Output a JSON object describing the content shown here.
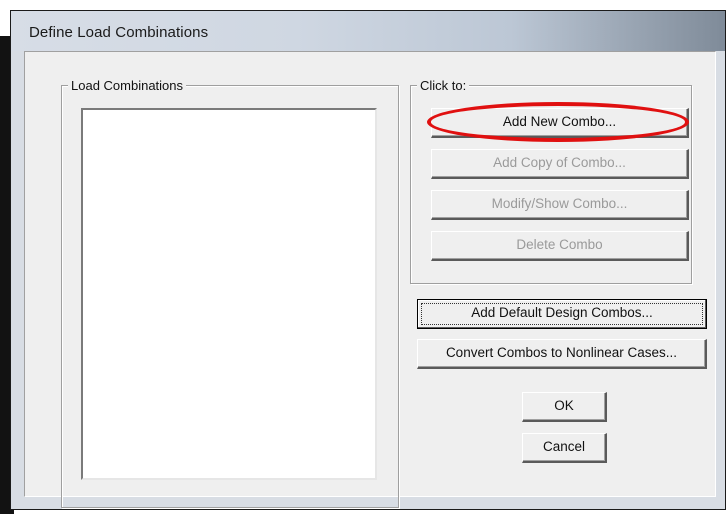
{
  "window": {
    "title": "Define Load Combinations"
  },
  "load_combinations": {
    "group_label": "Load Combinations",
    "items": []
  },
  "click_to": {
    "group_label": "Click to:",
    "add_new_combo": "Add New Combo...",
    "add_copy_of_combo": "Add Copy of Combo...",
    "modify_show_combo": "Modify/Show Combo...",
    "delete_combo": "Delete Combo"
  },
  "actions": {
    "add_default_design_combos": "Add Default Design Combos...",
    "convert_combos": "Convert Combos to Nonlinear Cases...",
    "ok": "OK",
    "cancel": "Cancel"
  },
  "annotation": {
    "highlight_color": "#e01010",
    "highlight_target": "Add New Combo..."
  }
}
